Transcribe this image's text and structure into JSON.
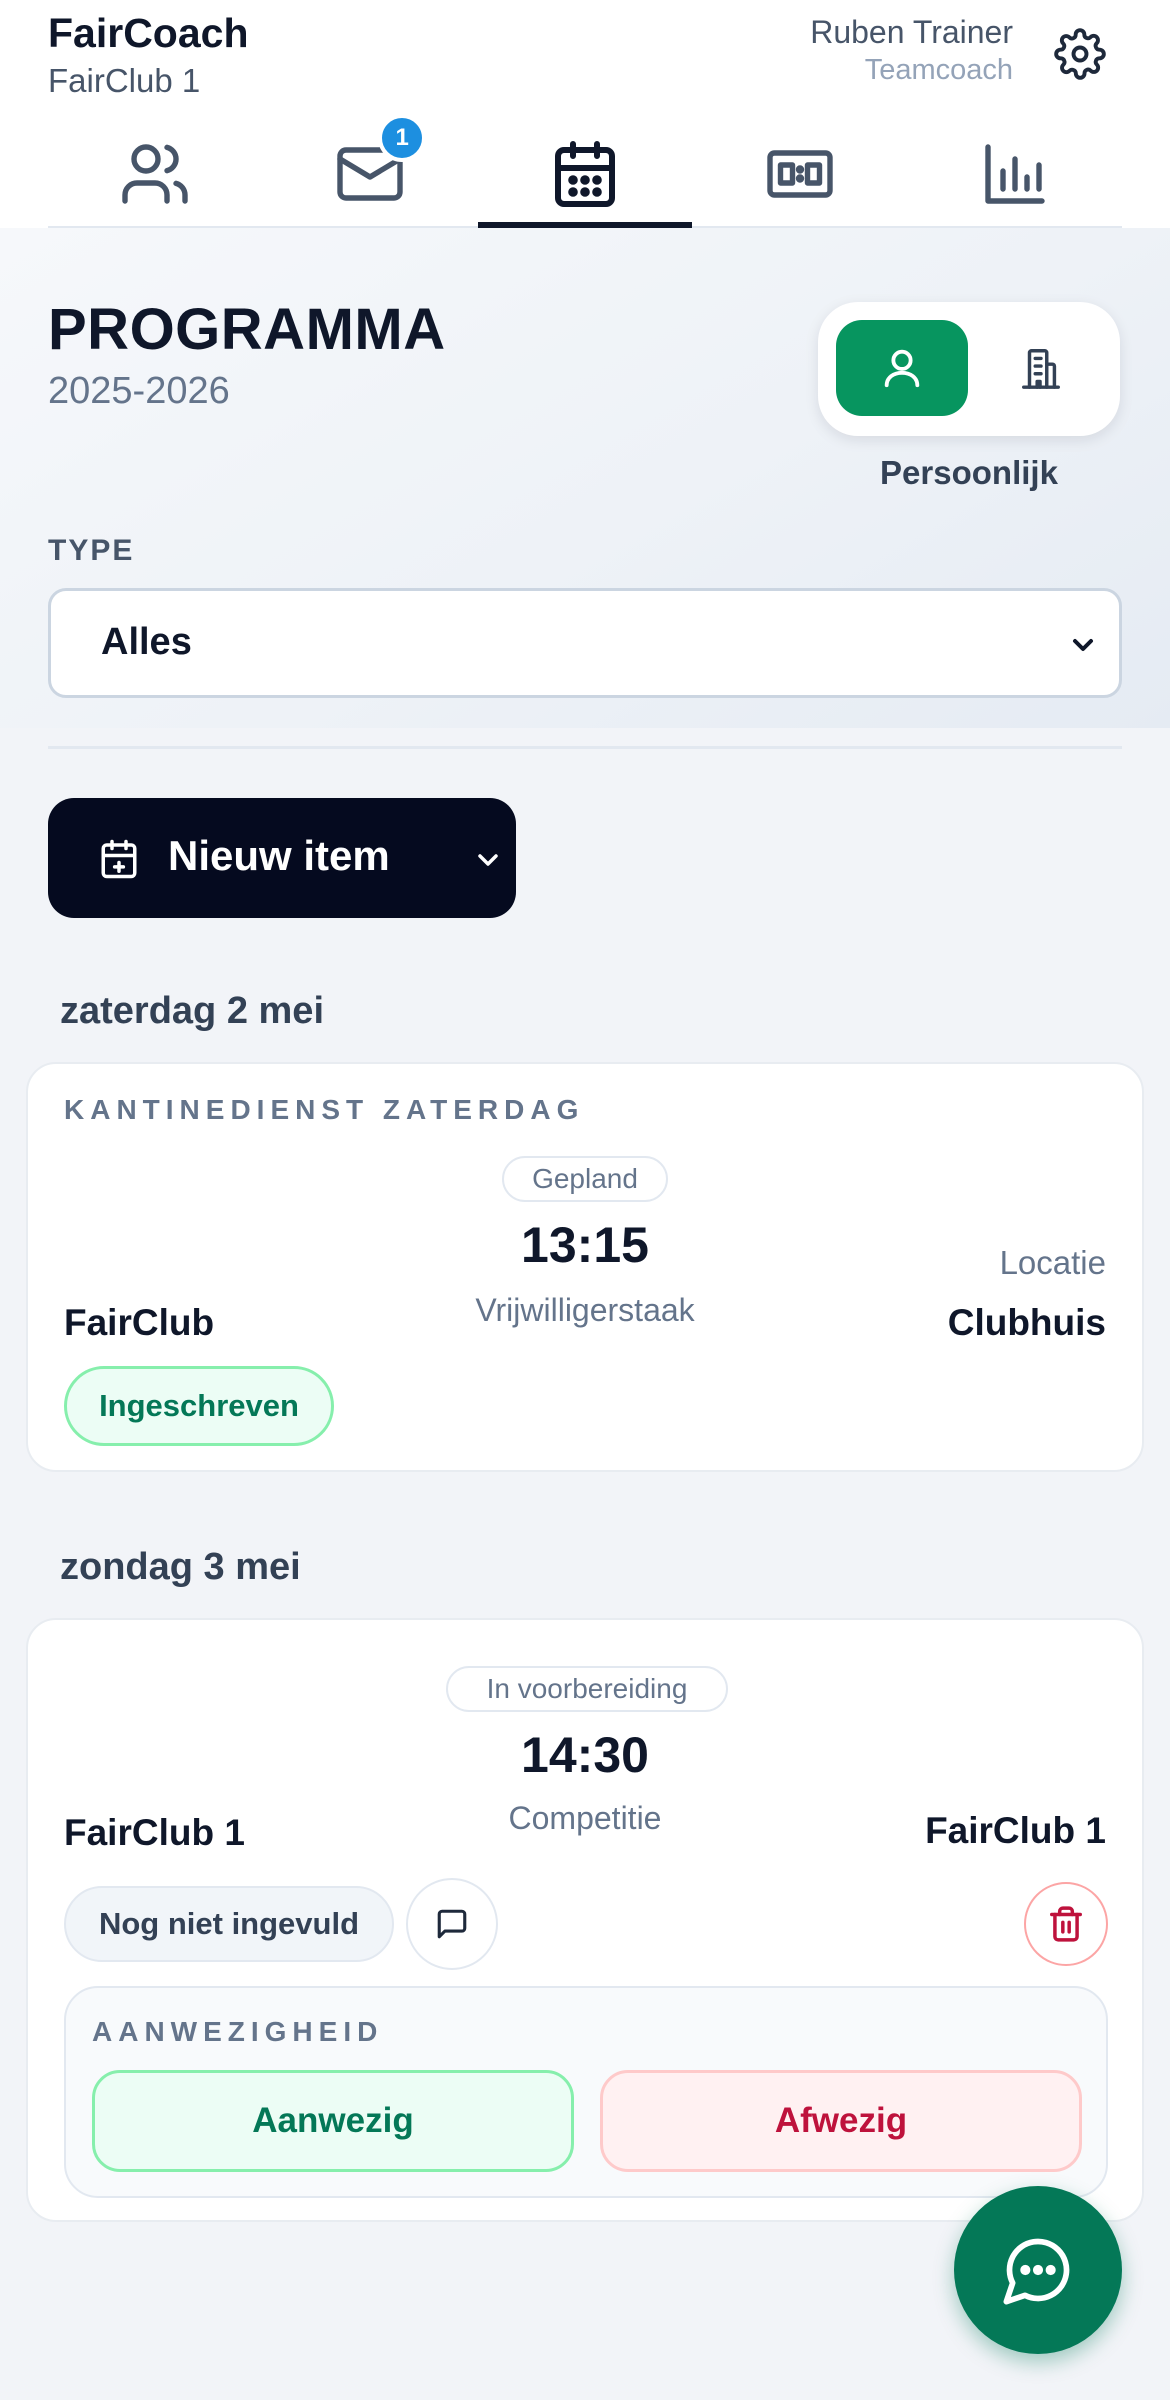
{
  "app": {
    "title": "FairCoach",
    "team": "FairClub 1"
  },
  "user": {
    "name": "Ruben Trainer",
    "role": "Teamcoach"
  },
  "tabs": [
    {
      "icon": "users-icon"
    },
    {
      "icon": "mail-icon",
      "badge": "1"
    },
    {
      "icon": "calendar-icon",
      "active": true
    },
    {
      "icon": "scoreboard-icon"
    },
    {
      "icon": "bar-chart-icon"
    }
  ],
  "page": {
    "title": "PROGRAMMA",
    "season": "2025-2026"
  },
  "view_toggle": {
    "selected": "personal",
    "label": "Persoonlijk",
    "accent": "#07955f"
  },
  "filter": {
    "label": "TYPE",
    "value": "Alles"
  },
  "new_item": {
    "label": "Nieuw item"
  },
  "days": [
    {
      "heading": "zaterdag 2 mei",
      "event": {
        "category": "KANTINEDIENST ZATERDAG",
        "status": "Gepland",
        "time": "13:15",
        "type": "Vrijwilligerstaak",
        "left_team": "FairClub",
        "location_label": "Locatie",
        "location": "Clubhuis",
        "signup_status": "Ingeschreven"
      }
    },
    {
      "heading": "zondag 3 mei",
      "event": {
        "status": "In voorbereiding",
        "time": "14:30",
        "type": "Competitie",
        "left_team": "FairClub 1",
        "right_team": "FairClub 1",
        "fill_status": "Nog niet ingevuld",
        "attendance": {
          "label": "AANWEZIGHEID",
          "yes": "Aanwezig",
          "no": "Afwezig"
        }
      }
    }
  ]
}
